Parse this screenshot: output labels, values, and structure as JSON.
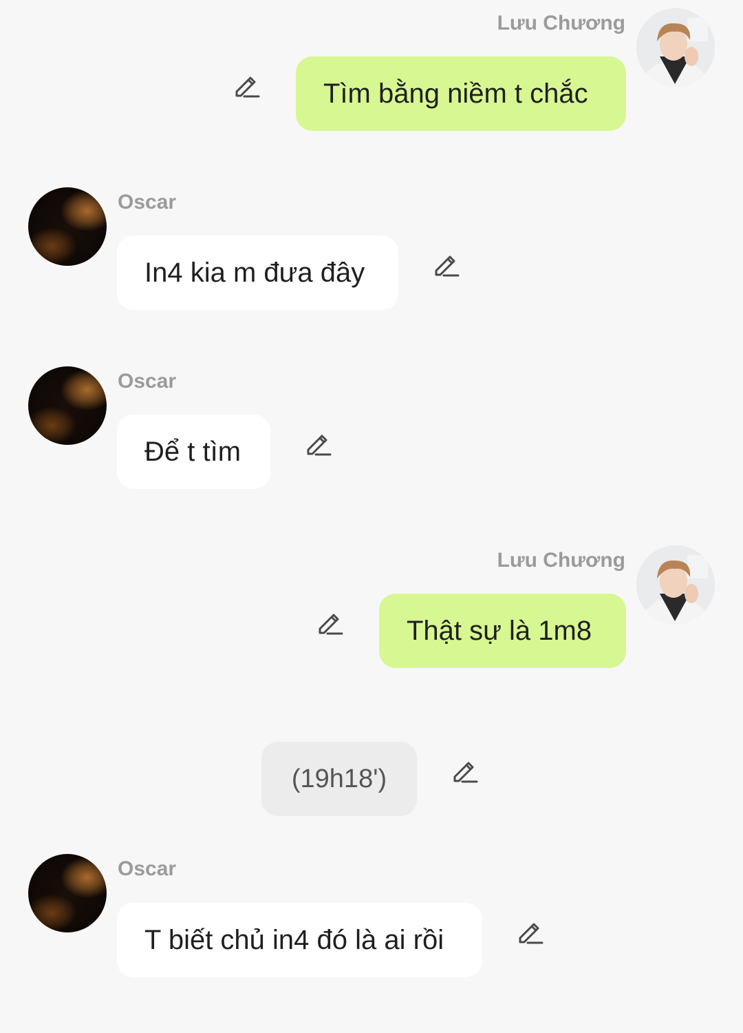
{
  "messages": [
    {
      "sender": "Lưu Chương",
      "direction": "sent",
      "text": "Tìm bằng niềm t chắc"
    },
    {
      "sender": "Oscar",
      "direction": "received",
      "text": "In4 kia m đưa đây"
    },
    {
      "sender": "Oscar",
      "direction": "received",
      "text": "Để t tìm"
    },
    {
      "sender": "Lưu Chương",
      "direction": "sent",
      "text": "Thật sự là 1m8"
    },
    {
      "direction": "system",
      "text": "(19h18')"
    },
    {
      "sender": "Oscar",
      "direction": "received",
      "text": "T biết chủ in4 đó là ai rồi"
    }
  ],
  "icons": {
    "edit": "pencil-edit-icon",
    "avatar_oscar": "oscar-avatar",
    "avatar_luu": "luu-chuong-avatar"
  },
  "colors": {
    "background": "#f7f7f7",
    "sent_bubble": "#d7f792",
    "received_bubble": "#ffffff",
    "time_bubble": "#ececec",
    "sender_name": "#9b9b9b"
  }
}
